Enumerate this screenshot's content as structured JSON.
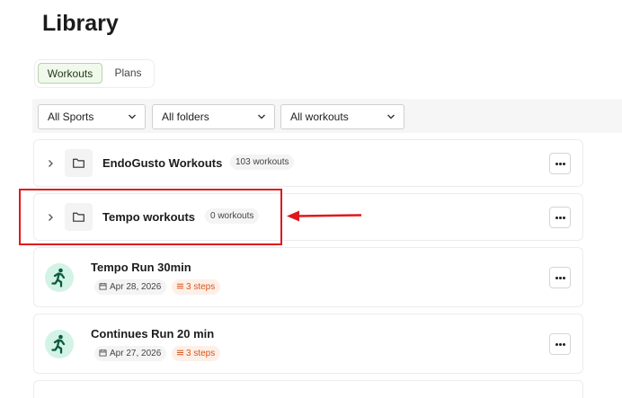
{
  "page": {
    "title": "Library"
  },
  "tabs": [
    {
      "label": "Workouts",
      "active": true
    },
    {
      "label": "Plans",
      "active": false
    }
  ],
  "filters": [
    {
      "selected": "All Sports"
    },
    {
      "selected": "All folders"
    },
    {
      "selected": "All workouts"
    }
  ],
  "folders": [
    {
      "name": "EndoGusto Workouts",
      "count": "103 workouts"
    },
    {
      "name": "Tempo workouts",
      "count": "0 workouts"
    }
  ],
  "workouts": [
    {
      "name": "Tempo Run 30min",
      "date": "Apr 28, 2026",
      "steps": "3 steps"
    },
    {
      "name": "Continues Run 20 min",
      "date": "Apr 27, 2026",
      "steps": "3 steps"
    }
  ],
  "icons": {
    "expand": "chevron-right-icon",
    "folder": "folder-icon",
    "more": "more-horizontal-icon",
    "workout": "running-person-icon",
    "date": "calendar-icon",
    "steps": "list-icon",
    "dropdown": "chevron-down-icon"
  },
  "colors": {
    "tab_active_bg": "#f1f8ec",
    "tab_active_border": "#b9d3a9",
    "workout_icon_bg": "#d2f3e6",
    "workout_icon": "#0b5b3e",
    "steps_text": "#d9541c",
    "steps_bg": "#fdf0e8",
    "annotation": "#e0181c"
  }
}
